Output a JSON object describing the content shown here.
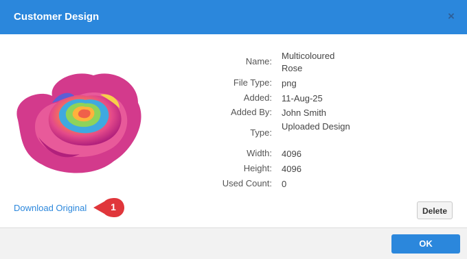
{
  "dialog": {
    "title": "Customer Design",
    "close_icon": "×",
    "image_alt_subject": "rose-image",
    "details": [
      {
        "label": "Name:",
        "value": "Multicoloured Rose"
      },
      {
        "label": "File Type:",
        "value": "png"
      },
      {
        "label": "Added:",
        "value": "11-Aug-25"
      },
      {
        "label": "Added By:",
        "value": "John Smith"
      },
      {
        "label": "Type:",
        "value": "Uploaded Design"
      },
      {
        "label": "Width:",
        "value": "4096"
      },
      {
        "label": "Height:",
        "value": "4096"
      },
      {
        "label": "Used Count:",
        "value": "0"
      }
    ],
    "download_label": "Download Original",
    "badge_number": "1",
    "delete_label": "Delete",
    "ok_label": "OK"
  },
  "colors": {
    "accent": "#2b87dc",
    "badge": "#e0363b"
  }
}
